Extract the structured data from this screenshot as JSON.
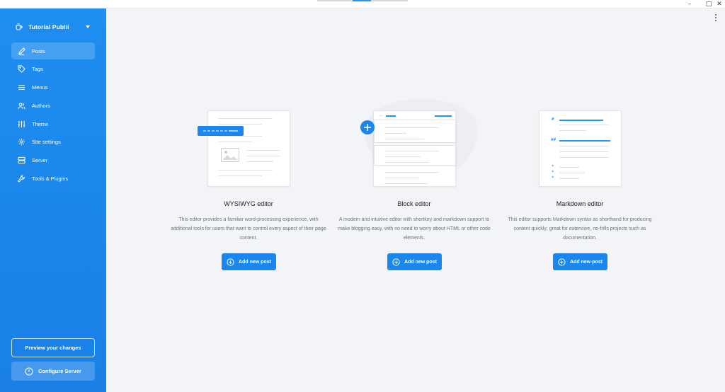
{
  "sidebar": {
    "site_name": "Tutorial Publii",
    "items": [
      {
        "label": "Posts",
        "icon": "pencil-icon",
        "active": true
      },
      {
        "label": "Tags",
        "icon": "tag-icon",
        "active": false
      },
      {
        "label": "Menus",
        "icon": "menu-icon",
        "active": false
      },
      {
        "label": "Authors",
        "icon": "users-icon",
        "active": false
      },
      {
        "label": "Theme",
        "icon": "sliders-icon",
        "active": false
      },
      {
        "label": "Site settings",
        "icon": "gear-icon",
        "active": false
      },
      {
        "label": "Server",
        "icon": "server-icon",
        "active": false
      },
      {
        "label": "Tools & Plugins",
        "icon": "wrench-icon",
        "active": false
      }
    ],
    "preview_label": "Preview your changes",
    "configure_label": "Configure Server"
  },
  "editors": [
    {
      "title": "WYSIWYG editor",
      "description": "This editor provides a familiar word-processing experience, with additional tools for users that want to control every aspect of their page content.",
      "button_label": "Add new post"
    },
    {
      "title": "Block editor",
      "description": "A modern and intuitive editor with shortkey and markdown support to make blogging easy, with no need to worry about HTML or other code elements.",
      "button_label": "Add new post"
    },
    {
      "title": "Markdown editor",
      "description": "This editor supports Markdown syntax as shorthand for producing content quickly; great for extensive, no-frills projects such as documentation.",
      "button_label": "Add new post"
    }
  ],
  "markdown_illustration": {
    "h1": "#",
    "h2": "##",
    "bullet": "*"
  },
  "colors": {
    "accent": "#1a86ee",
    "sidebar": "#1e8ef0",
    "background": "#f3f4f7"
  }
}
